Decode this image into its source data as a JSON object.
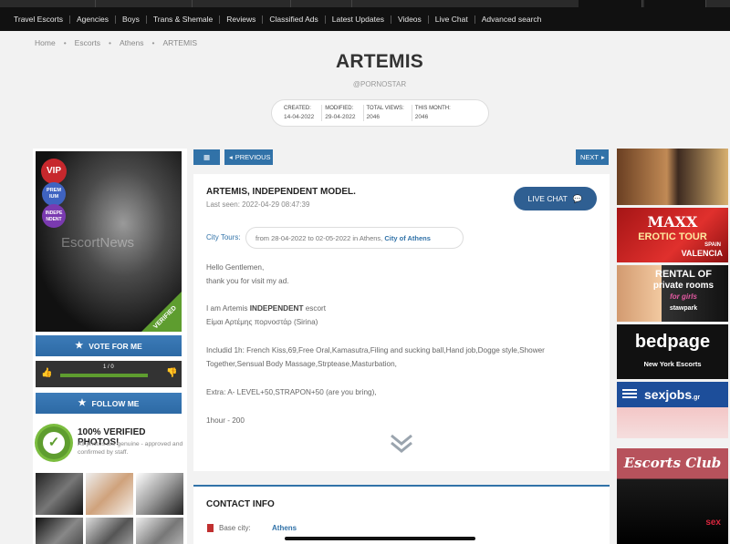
{
  "nav": {
    "items": [
      "Travel Escorts",
      "Agencies",
      "Boys",
      "Trans & Shemale",
      "Reviews",
      "Classified Ads",
      "Latest Updates",
      "Videos",
      "Live Chat",
      "Advanced search"
    ]
  },
  "breadcrumb": [
    "Home",
    "Escorts",
    "Athens",
    "ARTEMIS"
  ],
  "profile": {
    "title": "ARTEMIS",
    "username": "@PORNOSTAR",
    "stats": [
      {
        "label": "CREATED:",
        "value": "14-04-2022"
      },
      {
        "label": "MODIFIED:",
        "value": "29-04-2022"
      },
      {
        "label": "TOTAL VIEWS:",
        "value": "2046"
      },
      {
        "label": "THIS MONTH:",
        "value": "2046"
      }
    ]
  },
  "left": {
    "watermark": "EscortNews",
    "badges": {
      "vip": "VIP",
      "premium": "PREM IUM",
      "independent": "INDEPE NDENT"
    },
    "verified_ribbon": "VERIFIED",
    "vote_label": "VOTE FOR ME",
    "vote_count": "1 / 0",
    "follow_label": "FOLLOW ME",
    "verified_title": "100% VERIFIED PHOTOS!",
    "verified_desc": "All photos are genuine - approved and confirmed by staff."
  },
  "toolbar": {
    "prev_label": "PREVIOUS",
    "next_label": "NEXT"
  },
  "card": {
    "name": "ARTEMIS, INDEPENDENT MODEL.",
    "last_seen": "Last seen: 2022-04-29 08:47:39",
    "live_chat": "LIVE CHAT",
    "city_label": "City Tours:",
    "city_text": "from 28-04-2022 to 02-05-2022 in Athens,",
    "city_link": "City of Athens",
    "lines": [
      {
        "text": "Hello Gentlemen,"
      },
      {
        "text": "thank you for visit my ad."
      },
      {
        "text": "I am Artemis",
        "bold": "INDEPENDENT",
        "after": "escort"
      },
      {
        "text": "Είμαι Αρτέμης πορνοστάρ (Sirina)"
      },
      {
        "text": "Includid 1h: French Kiss,69,Free Oral,Kamasutra,Filing and sucking ball,Hand job,Dogge style,Shower"
      },
      {
        "text": "Together,Sensual Body Massage,Strptease,Masturbation,"
      },
      {
        "text": "Extra: A- LEVEL+50,STRAPON+50 (are you bring),"
      },
      {
        "text": "1hour - 200"
      }
    ]
  },
  "contact": {
    "title": "CONTACT INFO",
    "base_city_label": "Base city:",
    "base_city_value": "Athens"
  },
  "ads": {
    "maxx": {
      "line1": "MAXX",
      "line2": "EROTIC TOUR",
      "line3": "SPAIN",
      "line4": "VALENCIA"
    },
    "rental": {
      "line1": "RENTAL OF",
      "line2": "private rooms",
      "line3": "for girls",
      "logo": "stawpark"
    },
    "bedpage": {
      "line1": "bedpage",
      "line2": "New York Escorts"
    },
    "sexjobs": {
      "line1": "sexjobs",
      "suffix": ".gr"
    },
    "club": {
      "line1": "Escorts Club",
      "tag": "sex"
    }
  },
  "colors": {
    "accent": "#3172a8",
    "nav_bg": "#111111",
    "verified": "#5e9d2f",
    "vip": "#c7282d"
  }
}
